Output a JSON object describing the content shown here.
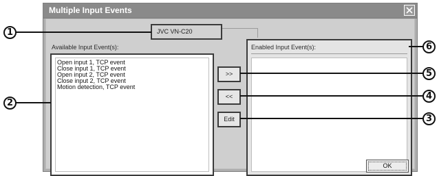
{
  "window": {
    "title": "Multiple Input Events",
    "close_glyph": "close-icon"
  },
  "device": {
    "name": "JVC VN-C20"
  },
  "available": {
    "label": "Available Input Event(s):",
    "items": [
      "Open input 1, TCP event",
      "Close input 1, TCP event",
      "Open input 2, TCP event",
      "Close input 2, TCP event",
      "Motion detection, TCP event"
    ]
  },
  "enabled": {
    "label": "Enabled Input Event(s):",
    "items": []
  },
  "buttons": {
    "add": ">>",
    "remove": "<<",
    "edit": "Edit",
    "ok": "OK"
  },
  "callouts": {
    "c1": "1",
    "c2": "2",
    "c3": "3",
    "c4": "4",
    "c5": "5",
    "c6": "6"
  },
  "colors": {
    "titlebar": "#8a8a8a",
    "client": "#cfcfcf",
    "highlight_border": "#3a3a3a"
  }
}
